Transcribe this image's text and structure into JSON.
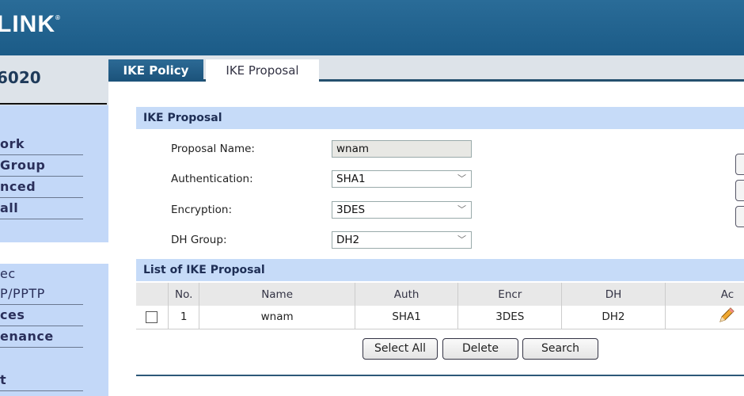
{
  "header": {
    "logo": "LINK",
    "logo_mark": "®"
  },
  "sidebar": {
    "model": "6020",
    "group1": [
      "ork",
      "Group",
      "nced",
      "all"
    ],
    "group2": [
      "ec",
      "P/PPTP",
      "ces",
      "enance",
      "t"
    ]
  },
  "tabs": [
    {
      "label": "IKE Policy",
      "active": false
    },
    {
      "label": "IKE Proposal",
      "active": true
    }
  ],
  "form": {
    "title": "IKE Proposal",
    "fields": [
      {
        "label": "Proposal Name:",
        "value": "wnam",
        "type": "text",
        "readonly": true
      },
      {
        "label": "Authentication:",
        "value": "SHA1",
        "type": "select"
      },
      {
        "label": "Encryption:",
        "value": "3DES",
        "type": "select"
      },
      {
        "label": "DH Group:",
        "value": "DH2",
        "type": "select"
      }
    ]
  },
  "list": {
    "title": "List of IKE Proposal",
    "columns": [
      "",
      "No.",
      "Name",
      "Auth",
      "Encr",
      "DH",
      "Ac"
    ],
    "rows": [
      {
        "no": "1",
        "name": "wnam",
        "auth": "SHA1",
        "encr": "3DES",
        "dh": "DH2",
        "action_icon": "pencil-icon"
      }
    ],
    "buttons": {
      "select_all": "Select All",
      "delete": "Delete",
      "search": "Search"
    }
  }
}
